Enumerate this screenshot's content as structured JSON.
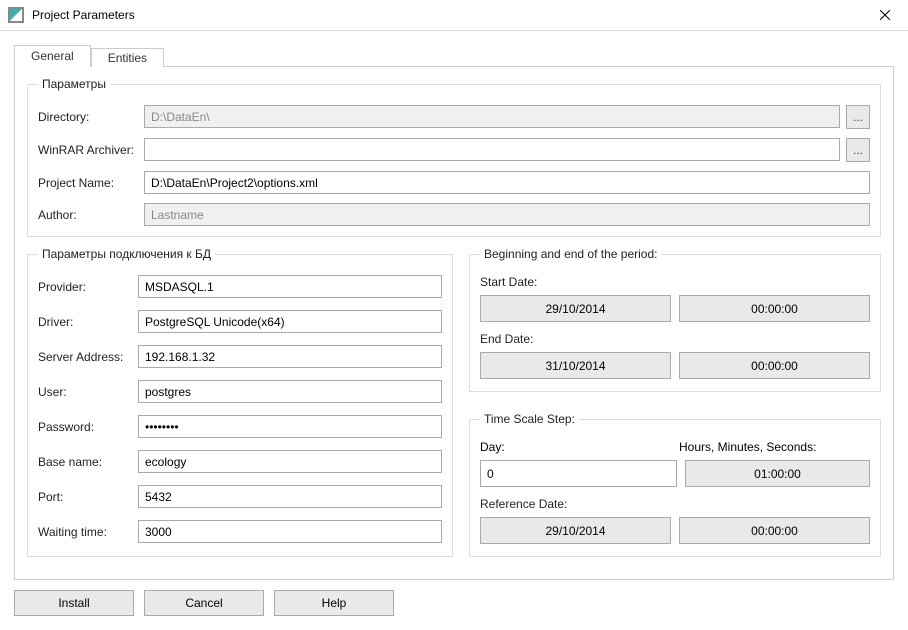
{
  "window": {
    "title": "Project Parameters"
  },
  "tabs": {
    "general": "General",
    "entities": "Entities"
  },
  "groups": {
    "params_legend": "Параметры",
    "db_legend": "Параметры подключения к БД",
    "period_legend": "Beginning and end of the period:",
    "timescale_legend": "Time Scale Step:"
  },
  "params": {
    "directory_label": "Directory:",
    "directory_value": "D:\\DataEn\\",
    "winrar_label": "WinRAR Archiver:",
    "winrar_value": "",
    "project_name_label": "Project Name:",
    "project_name_value": "D:\\DataEn\\Project2\\options.xml",
    "author_label": "Author:",
    "author_placeholder": "Lastname",
    "browse_label": "..."
  },
  "db": {
    "provider_label": "Provider:",
    "provider_value": "MSDASQL.1",
    "driver_label": "Driver:",
    "driver_value": "PostgreSQL Unicode(x64)",
    "server_label": "Server Address:",
    "server_value": "192.168.1.32",
    "user_label": "User:",
    "user_value": "postgres",
    "password_label": "Password:",
    "password_value": "••••••••",
    "base_label": "Base name:",
    "base_value": "ecology",
    "port_label": "Port:",
    "port_value": "5432",
    "wait_label": "Waiting time:",
    "wait_value": "3000"
  },
  "period": {
    "start_label": "Start Date:",
    "start_date": "29/10/2014",
    "start_time": "00:00:00",
    "end_label": "End Date:",
    "end_date": "31/10/2014",
    "end_time": "00:00:00"
  },
  "timescale": {
    "day_label": "Day:",
    "hms_label": "Hours, Minutes, Seconds:",
    "day_value": "0",
    "hms_value": "01:00:00",
    "ref_label": "Reference Date:",
    "ref_date": "29/10/2014",
    "ref_time": "00:00:00"
  },
  "buttons": {
    "install": "Install",
    "cancel": "Cancel",
    "help": "Help"
  }
}
